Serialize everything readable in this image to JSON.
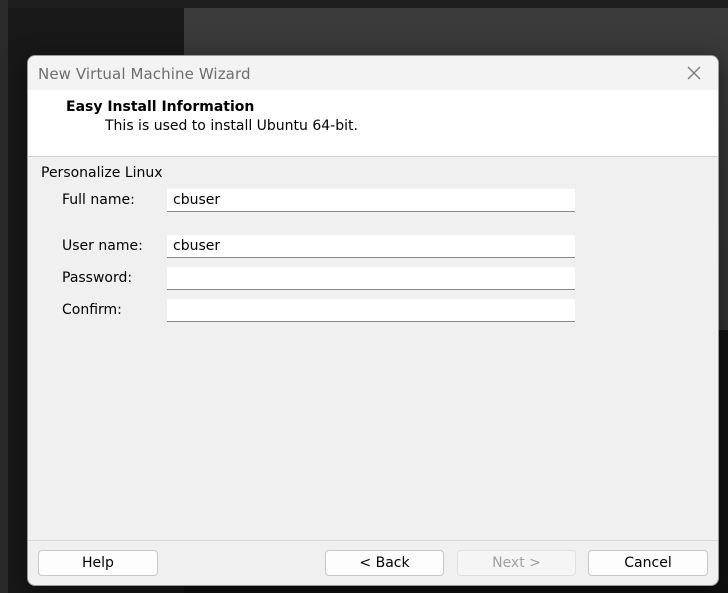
{
  "window": {
    "title": "New Virtual Machine Wizard"
  },
  "header": {
    "title": "Easy Install Information",
    "subtitle": "This is used to install Ubuntu 64-bit."
  },
  "section": {
    "label": "Personalize Linux"
  },
  "fields": {
    "full_name": {
      "label": "Full name:",
      "value": "cbuser"
    },
    "user_name": {
      "label": "User name:",
      "value": "cbuser"
    },
    "password": {
      "label": "Password:",
      "value": ""
    },
    "confirm": {
      "label": "Confirm:",
      "value": ""
    }
  },
  "buttons": {
    "help": "Help",
    "back": "< Back",
    "next": "Next >",
    "cancel": "Cancel"
  },
  "icons": {
    "close": "close-icon"
  }
}
